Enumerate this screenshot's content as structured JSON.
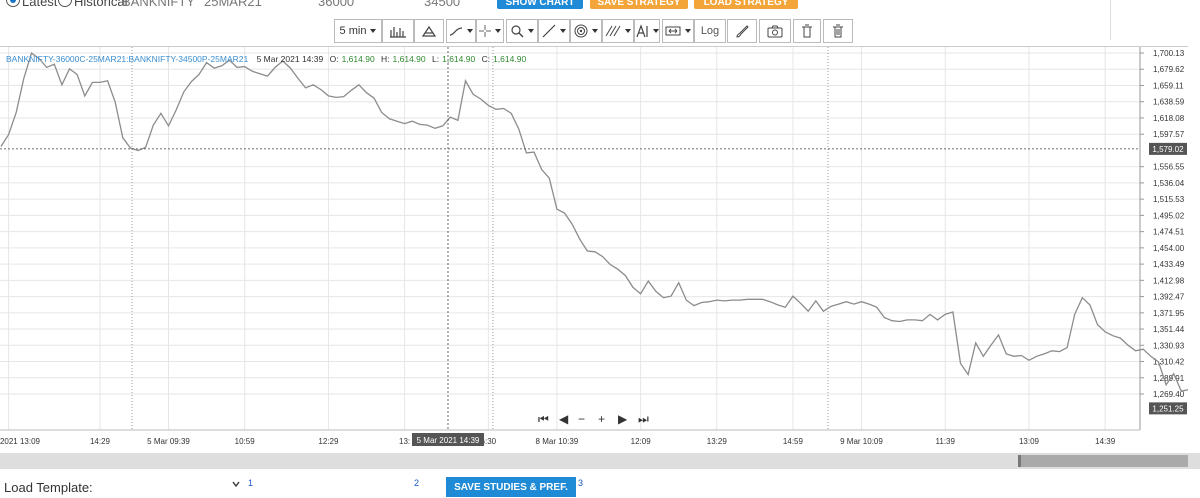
{
  "header": {
    "radio_latest_label": "Latest",
    "radio_historical_label": "Historical",
    "symbol_select_value": "BANKNIFTY",
    "expiry_select_value": "25MAR21",
    "strike1_value": "36000",
    "strike2_value": "34500",
    "show_chart_label": "SHOW CHART",
    "save_strategy_label": "SAVE STRATEGY",
    "load_strategy_label": "LOAD STRATEGY"
  },
  "toolbar": {
    "interval_label": "5 min",
    "log_label": "Log"
  },
  "legend": {
    "symbol": "BANKNIFTY-36000C-25MAR21:BANKNIFTY-34500P-25MAR21",
    "datetime": "5 Mar 2021 14:39",
    "o_label": "O:",
    "o_value": "1,614.90",
    "h_label": "H:",
    "h_value": "1,614.90",
    "l_label": "L:",
    "l_value": "1,614.90",
    "c_label": "C:",
    "c_value": "1,614.90"
  },
  "crosshair": {
    "time_label": "5 Mar 2021 14:39",
    "price_label": "1,579.02"
  },
  "chart_data": {
    "type": "line",
    "title": "",
    "xlabel": "",
    "ylabel": "",
    "ylim": [
      1230,
      1710
    ],
    "grid": true,
    "y_ticks": [
      "1,700.13",
      "1,679.62",
      "1,659.11",
      "1,638.59",
      "1,618.08",
      "1,597.57",
      "1,556.55",
      "1,536.04",
      "1,515.53",
      "1,495.02",
      "1,474.51",
      "1,454.00",
      "1,433.49",
      "1,412.98",
      "1,392.47",
      "1,371.95",
      "1,351.44",
      "1,330.93",
      "1,310.42",
      "1,289.91",
      "1,269.40"
    ],
    "y_tick_values": [
      1700.13,
      1679.62,
      1659.11,
      1638.59,
      1618.08,
      1597.57,
      1556.55,
      1536.04,
      1515.53,
      1495.02,
      1474.51,
      1454.0,
      1433.49,
      1412.98,
      1392.47,
      1371.95,
      1351.44,
      1330.93,
      1310.42,
      1289.91,
      1269.4
    ],
    "x_ticks": [
      "4 Mar 2021 13:09",
      "14:29",
      "5 Mar 09:39",
      "10:59",
      "12:29",
      "13:",
      "6:30",
      "8 Mar 10:39",
      "12:09",
      "13:29",
      "14:59",
      "9 Mar 10:09",
      "11:39",
      "13:09",
      "14:39"
    ],
    "x_tick_index": [
      1,
      13,
      22,
      32,
      43,
      53,
      64,
      73,
      84,
      94,
      104,
      113,
      124,
      135,
      145
    ],
    "day_breaks_index": [
      17.2,
      64.6,
      108.6
    ],
    "crosshair_index": 58.7,
    "crosshair_value": 1579.02,
    "last_price_label": "1,251.25",
    "last_price": 1251.25,
    "series": [
      {
        "values": [
          1582,
          1597,
          1625,
          1668,
          1700,
          1693,
          1682,
          1686,
          1660,
          1680,
          1673,
          1646,
          1663,
          1663,
          1665,
          1638,
          1593,
          1580,
          1577,
          1581,
          1609,
          1624,
          1608,
          1628,
          1651,
          1664,
          1673,
          1688,
          1681,
          1684,
          1691,
          1682,
          1683,
          1677,
          1674,
          1671,
          1682,
          1690,
          1681,
          1668,
          1656,
          1660,
          1654,
          1646,
          1644,
          1645,
          1653,
          1660,
          1650,
          1643,
          1625,
          1617,
          1614,
          1611,
          1614,
          1610,
          1609,
          1605,
          1608,
          1619,
          1615,
          1665,
          1648,
          1642,
          1634,
          1629,
          1630,
          1624,
          1604,
          1574,
          1575,
          1553,
          1542,
          1503,
          1498,
          1484,
          1465,
          1450,
          1449,
          1443,
          1433,
          1427,
          1419,
          1404,
          1396,
          1412,
          1399,
          1391,
          1393,
          1410,
          1388,
          1381,
          1385,
          1386,
          1388,
          1387,
          1388,
          1388,
          1389,
          1389,
          1389,
          1386,
          1382,
          1379,
          1393,
          1384,
          1374,
          1387,
          1374,
          1380,
          1383,
          1386,
          1383,
          1386,
          1383,
          1379,
          1366,
          1362,
          1361,
          1363,
          1363,
          1362,
          1370,
          1363,
          1370,
          1373,
          1308,
          1294,
          1334,
          1317,
          1331,
          1344,
          1320,
          1317,
          1318,
          1312,
          1317,
          1320,
          1324,
          1323,
          1328,
          1370,
          1391,
          1382,
          1357,
          1348,
          1343,
          1340,
          1331,
          1324,
          1326,
          1317,
          1310,
          1281,
          1295,
          1273,
          1275,
          1269,
          1265,
          1256,
          1258,
          1242,
          1244,
          1256,
          1251
        ]
      }
    ]
  },
  "nav_controls": [
    "⏮",
    "◀",
    "−",
    "+",
    "▶",
    "⏭"
  ],
  "bottom": {
    "load_template_label": "Load Template:",
    "sup1": "1",
    "sup2": "2",
    "sup3": "3",
    "save_studies_label": "SAVE STUDIES & PREF."
  }
}
